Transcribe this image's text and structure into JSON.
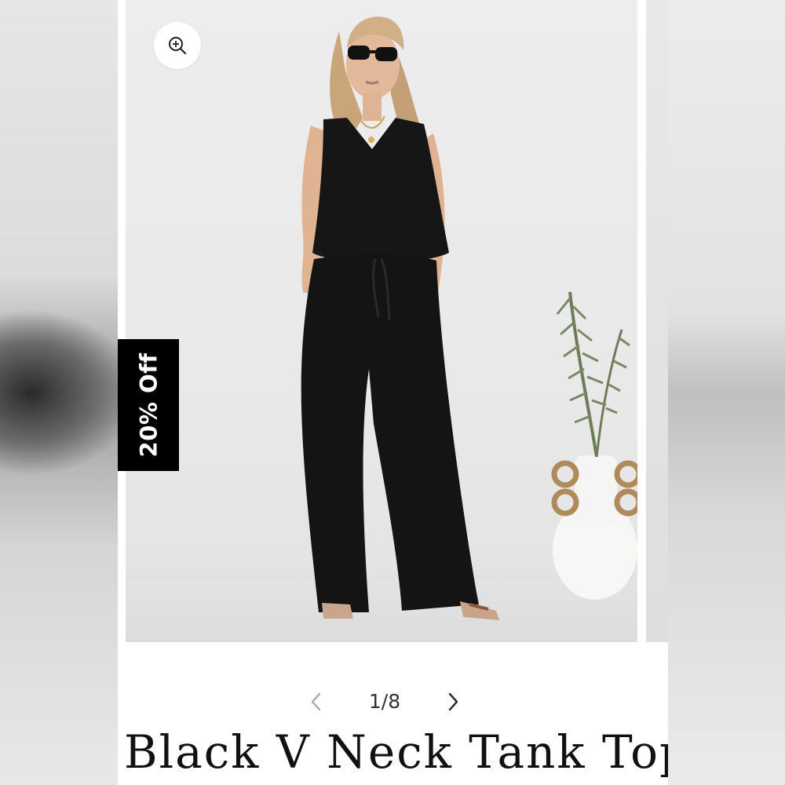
{
  "product": {
    "title": "Black V Neck Tank Top",
    "discount_badge": "20% Off"
  },
  "gallery": {
    "current": "1/8",
    "zoom_icon": "zoom-in-icon",
    "prev_icon": "chevron-left-icon",
    "next_icon": "chevron-right-icon"
  },
  "colors": {
    "badge_bg": "#000000",
    "badge_text": "#ffffff",
    "outfit": "#141414"
  }
}
